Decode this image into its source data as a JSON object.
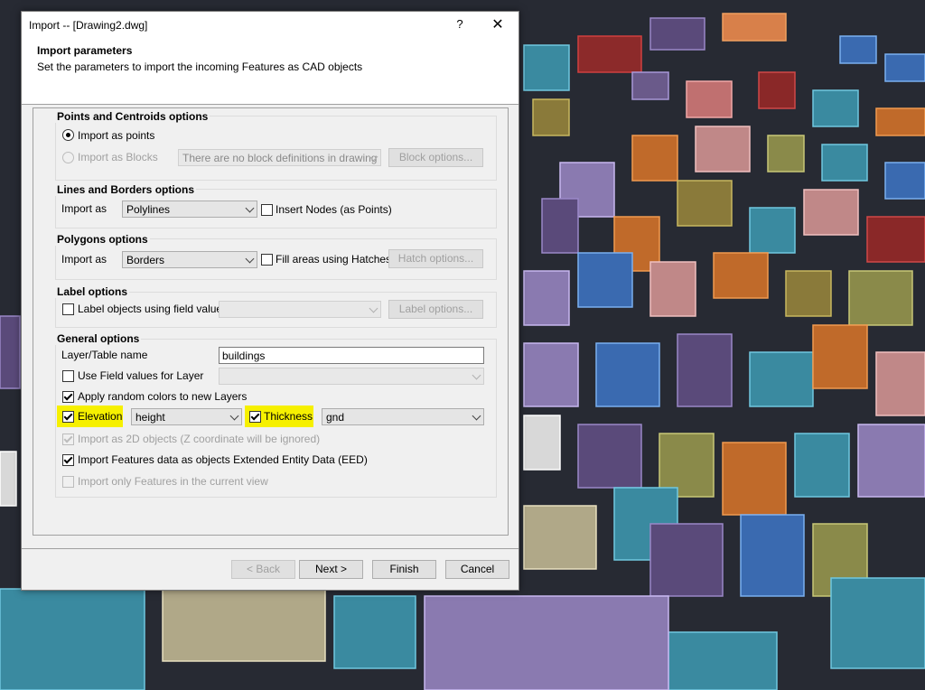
{
  "window": {
    "title": "Import -- [Drawing2.dwg]",
    "help_glyph": "?",
    "close_glyph": "✕"
  },
  "header": {
    "title": "Import parameters",
    "subtitle": "Set the parameters to import the incoming Features as CAD objects"
  },
  "points": {
    "group_title": "Points and Centroids options",
    "import_as_points": "Import as points",
    "import_as_blocks": "Import as Blocks",
    "block_combo_value": "There are no block definitions in drawing",
    "block_options_button": "Block options..."
  },
  "lines": {
    "group_title": "Lines and Borders options",
    "import_as_label": "Import as",
    "import_as_value": "Polylines",
    "insert_nodes": "Insert Nodes (as Points)"
  },
  "polygons": {
    "group_title": "Polygons options",
    "import_as_label": "Import as",
    "import_as_value": "Borders",
    "fill_areas": "Fill areas using Hatches",
    "hatch_options_button": "Hatch options..."
  },
  "labels": {
    "group_title": "Label options",
    "label_objects": "Label objects using field value",
    "label_options_button": "Label options..."
  },
  "general": {
    "group_title": "General options",
    "layer_name_label": "Layer/Table name",
    "layer_name_value": "buildings",
    "use_field_values": "Use Field values for Layer",
    "apply_random_colors": "Apply random colors to new Layers",
    "elevation_label": "Elevation",
    "elevation_value": "height",
    "thickness_label": "Thickness",
    "thickness_value": "gnd",
    "import_2d": "Import as 2D objects (Z coordinate will be ignored)",
    "import_eed": "Import Features data as objects Extended Entity Data (EED)",
    "import_current_view": "Import only Features in the current view"
  },
  "buttons": {
    "back": "< Back",
    "next": "Next >",
    "finish": "Finish",
    "cancel": "Cancel"
  },
  "colors": {
    "highlight": "#f6f000",
    "accent": "#0078d7",
    "scene_background": "#272a33"
  }
}
